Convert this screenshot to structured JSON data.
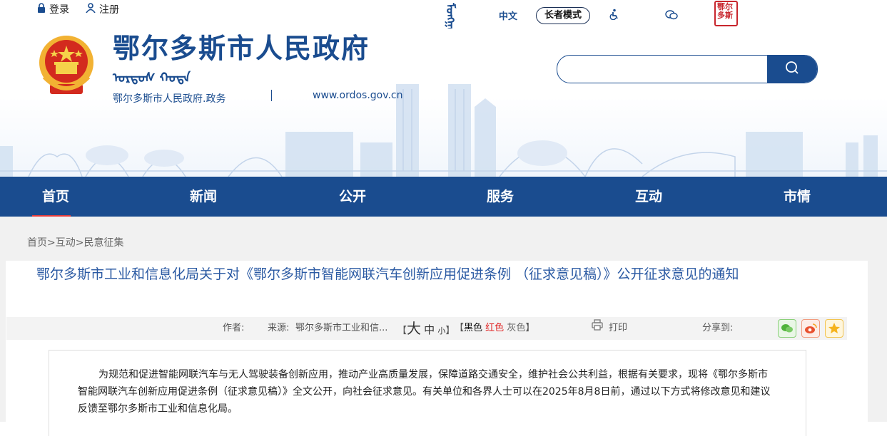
{
  "top_bar": {
    "login": "登录",
    "register": "注册",
    "lang_mongol": "ᠮᠣᠩᠭᠣᠯ",
    "lang_chinese": "中文",
    "elder_mode": "长者模式",
    "seal_text": "鄂尔多斯"
  },
  "brand": {
    "title": "鄂尔多斯市人民政府",
    "mongol_title": "ᠣᠷᠳᠣᠰ ᠬᠣᠲᠠ",
    "subtitle": "鄂尔多斯市人民政府.政务",
    "url": "www.ordos.gov.cn"
  },
  "search": {
    "placeholder": "",
    "value": ""
  },
  "nav": {
    "items": [
      {
        "label": "首页",
        "active": true
      },
      {
        "label": "新闻"
      },
      {
        "label": "公开"
      },
      {
        "label": "服务"
      },
      {
        "label": "互动"
      },
      {
        "label": "市情"
      }
    ]
  },
  "breadcrumb": {
    "home": "首页",
    "sep": ">",
    "section": "互动",
    "page": "民意征集"
  },
  "article": {
    "title": "鄂尔多斯市工业和信息化局关于对《鄂尔多斯市智能网联汽车创新应用促进条例 （征求意见稿）》公开征求意见的通知",
    "author_label": "作者:",
    "source_label": "来源:",
    "source_value": "鄂尔多斯市工业和信...",
    "font_open": "【",
    "font_big": "大",
    "font_mid": "中",
    "font_small": "小",
    "font_close": "】",
    "color_open": "【",
    "color_black": "黑色",
    "color_red": "红色",
    "color_gray": "灰色",
    "color_close": "】",
    "print": "打印",
    "share_label": "分享到:",
    "body": "为规范和促进智能网联汽车与无人驾驶装备创新应用，推动产业高质量发展，保障道路交通安全，维护社会公共利益，根据有关要求，现将《鄂尔多斯市智能网联汽车创新应用促进条例（征求意见稿）》全文公开，向社会征求意见。有关单位和各界人士可以在2025年8月8日前，通过以下方式将修改意见和建议反馈至鄂尔多斯市工业和信息化局。"
  },
  "colors": {
    "primary": "#1a4c8f",
    "accent_red": "#e63d3d",
    "title_blue": "#2b5aa3"
  }
}
